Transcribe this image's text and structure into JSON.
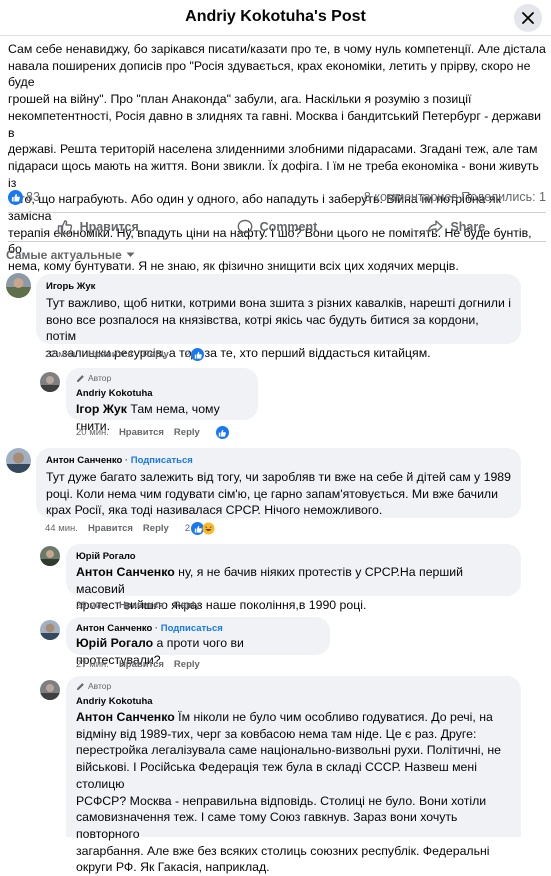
{
  "header": {
    "title": "Andriy Kokotuha's Post"
  },
  "post": {
    "lines": [
      "Сам себе ненавиджу, бо зарікався писати/казати про те, в чому нуль компетенції. Але дістала",
      "навала поширених дописів про \"Росія здувається, крах економіки, летить у прірву, скоро не буде",
      "грошей на війну\". Про \"план Анаконда\" забули, ага. Наскільки я розумію з позиції",
      "некомпетентності, Росія давно в злиднях та гавні. Москва і бандитський Петербург - держави в",
      "державі. Решта територій населена злиденними злобними підарасами. Згадані теж, але там",
      "підараси щось мають на життя. Вони звикли. Їх дофіга. І їм не треба економіка - вони живуть із",
      "того, що награбують. Або один у одного, або нападуть і заберуть. Війна їм потрібна як замісна",
      "терапія економіки. Ну, впадуть ціни на нафту. І шо? Вони цього не помітять. Не буде бунтів, бо",
      "нема, кому бунтувати. Я не знаю, як фізично знищити всіх цих ходячих мерців."
    ],
    "likes": "83",
    "comments": "8 комментариев",
    "shares": "Поделились: 1"
  },
  "actions": {
    "like": "Нравится",
    "comment": "Comment",
    "share": "Share"
  },
  "sort_label": "Самые актуальные",
  "meta_labels": {
    "like": "Нравится",
    "reply": "Reply",
    "author_badge": "Автор",
    "follow": "Подписаться"
  },
  "comments": [
    {
      "author": "Игорь Жук",
      "lines": [
        "Тут важливо, щоб нитки, котрими вона зшита з різних кавалків, нарешті догнили і",
        "воно все розпалося на князівства, котрі якісь час будуть битися за кордони, потім",
        "за залишки ресурсів, а тоді за те, хто перший віддасться китайцям."
      ],
      "time": "22 мин.",
      "reactions": "2"
    },
    {
      "author": "Andriy Kokotuha",
      "mention": "Ігор Жук",
      "text": "Там нема, чому гнити.",
      "time": "20 мин."
    },
    {
      "author": "Антон Санченко",
      "lines": [
        "Тут дуже багато залежить від тогу, чи заробляв ти вже на себе й дітей сам у 1989",
        "році. Коли нема чим годувати сім'ю, це гарно запам'ятовується. Ми вже бачили",
        "крах Росії, яка тоді називалася СРСР. Нічого неможливого."
      ],
      "time": "44 мин.",
      "reactions": "2"
    },
    {
      "author": "Юрій Рогало",
      "mention": "Антон Санченко",
      "lines": [
        " ну, я не бачив ніяких протестів у СРСР.На перший масовий",
        "протест вийшло якраз наше покоління,в 1990 році."
      ],
      "time": "29 мин."
    },
    {
      "author": "Антон Санченко",
      "mention": "Юрій Рогало",
      "text": " а проти чого ви протестували?",
      "time": "27 мин."
    },
    {
      "author": "Andriy Kokotuha",
      "mention": "Антон Санченко",
      "lines": [
        " Їм ніколи не було чим особливо годуватися. До речі, на",
        "відміну від 1989-тих, черг за ковбасою нема там ніде. Це є раз. Друге:",
        "перестройка легалізувала саме національно-визвольні рухи. Політичні, не",
        "військові. І Російська Федерація теж була в складі СССР. Назвеш мені столицю",
        "РСФСР? Москва - неправильна відповідь. Столиці не було. Вони хотіли",
        "самовизначення теж. І саме тому Союз гавкнув. Зараз вони хочуть повторного",
        "загарбання. Але вже без всяких столиць союзних республік. Федеральні",
        "округи РФ. Як Гакасія, наприклад."
      ]
    }
  ]
}
